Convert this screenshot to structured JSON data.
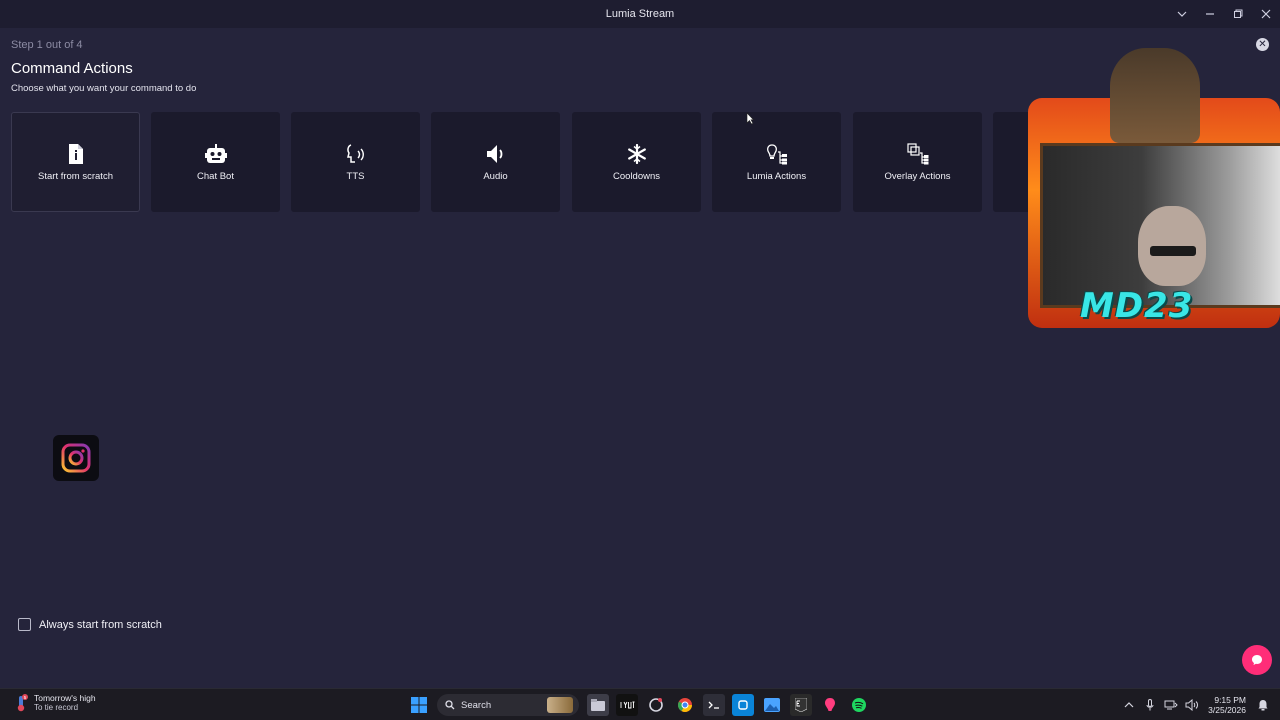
{
  "window": {
    "title": "Lumia Stream"
  },
  "wizard": {
    "step_text": "Step 1 out of 4",
    "heading": "Command Actions",
    "subheading": "Choose what you want your command to do"
  },
  "cards": [
    {
      "label": "Start from scratch",
      "icon": "file-info-icon",
      "selected": true
    },
    {
      "label": "Chat Bot",
      "icon": "robot-icon",
      "selected": false
    },
    {
      "label": "TTS",
      "icon": "speaking-head-icon",
      "selected": false
    },
    {
      "label": "Audio",
      "icon": "speaker-icon",
      "selected": false
    },
    {
      "label": "Cooldowns",
      "icon": "snowflake-icon",
      "selected": false
    },
    {
      "label": "Lumia Actions",
      "icon": "bulb-tree-icon",
      "selected": false
    },
    {
      "label": "Overlay Actions",
      "icon": "layers-tree-icon",
      "selected": false
    }
  ],
  "options": {
    "always_scratch_label": "Always start from scratch",
    "always_scratch_checked": false
  },
  "taskbar": {
    "weather_line1": "Tomorrow's high",
    "weather_line2": "To tie record",
    "weather_badge": "5",
    "search_label": "Search",
    "time": "9:15 PM",
    "date": "3/25/2026"
  },
  "overlay": {
    "logo_text": "MD23"
  },
  "colors": {
    "background": "#25243b",
    "card": "#1b1a2c",
    "accent_chat": "#ff2d78"
  }
}
